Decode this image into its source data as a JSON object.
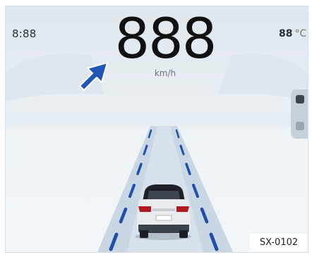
{
  "cluster": {
    "clock": "8:88",
    "speed": "888",
    "speed_unit": "km/h",
    "temperature_value": "88",
    "temperature_unit": "°C"
  },
  "figure_code": "SX-0102",
  "icons": {
    "callout": "arrow-callout-icon",
    "vehicle": "car-rear-icon",
    "right_widget": "side-widget-icon"
  },
  "colors": {
    "lane_marking": "#1f4fa8",
    "arrow": "#2156b8",
    "road": "#c9d7e5"
  }
}
